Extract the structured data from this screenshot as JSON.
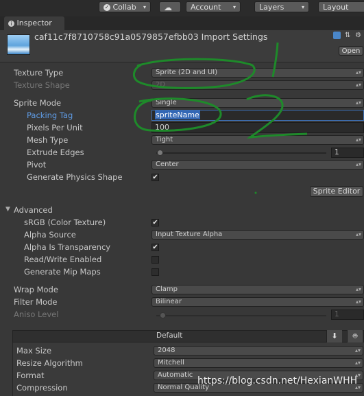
{
  "toolbar": {
    "collab": "Collab",
    "account": "Account",
    "layers": "Layers",
    "layout": "Layout"
  },
  "tab": {
    "label": "Inspector"
  },
  "header": {
    "title": "caf11c7f8710758c91a0579857efbb03 Import Settings",
    "open_label": "Open"
  },
  "props": {
    "texture_type": {
      "label": "Texture Type",
      "value": "Sprite (2D and UI)"
    },
    "texture_shape": {
      "label": "Texture Shape",
      "value": "2D"
    },
    "sprite_mode": {
      "label": "Sprite Mode",
      "value": "Single"
    },
    "packing_tag": {
      "label": "Packing Tag",
      "value": "spriteName"
    },
    "pixels_per_unit": {
      "label": "Pixels Per Unit",
      "value": "100"
    },
    "mesh_type": {
      "label": "Mesh Type",
      "value": "Tight"
    },
    "extrude_edges": {
      "label": "Extrude Edges",
      "value": "1"
    },
    "pivot": {
      "label": "Pivot",
      "value": "Center"
    },
    "generate_physics_shape": {
      "label": "Generate Physics Shape",
      "checked": true
    },
    "sprite_editor": "Sprite Editor"
  },
  "advanced": {
    "label": "Advanced",
    "srgb": {
      "label": "sRGB (Color Texture)",
      "checked": true
    },
    "alpha_source": {
      "label": "Alpha Source",
      "value": "Input Texture Alpha"
    },
    "alpha_transparency": {
      "label": "Alpha Is Transparency",
      "checked": true
    },
    "read_write": {
      "label": "Read/Write Enabled",
      "checked": false
    },
    "mip_maps": {
      "label": "Generate Mip Maps",
      "checked": false
    }
  },
  "wrap": {
    "wrap_mode": {
      "label": "Wrap Mode",
      "value": "Clamp"
    },
    "filter_mode": {
      "label": "Filter Mode",
      "value": "Bilinear"
    },
    "aniso_level": {
      "label": "Aniso Level",
      "value": "1"
    }
  },
  "platform": {
    "label": "Default",
    "download_icon": "download-icon",
    "android_icon": "android-icon",
    "max_size": {
      "label": "Max Size",
      "value": "2048"
    },
    "resize_algorithm": {
      "label": "Resize Algorithm",
      "value": "Mitchell"
    },
    "format": {
      "label": "Format",
      "value": "Automatic"
    },
    "compression": {
      "label": "Compression",
      "value": "Normal Quality"
    }
  },
  "annotations": {
    "mark1": "1",
    "mark2": "2"
  },
  "watermark": "https://blog.csdn.net/HexianWHH",
  "colors": {
    "background": "#383838",
    "annotation": "#1e8a2a",
    "selection": "#3367b5",
    "label_blue": "#5f9ce6"
  }
}
